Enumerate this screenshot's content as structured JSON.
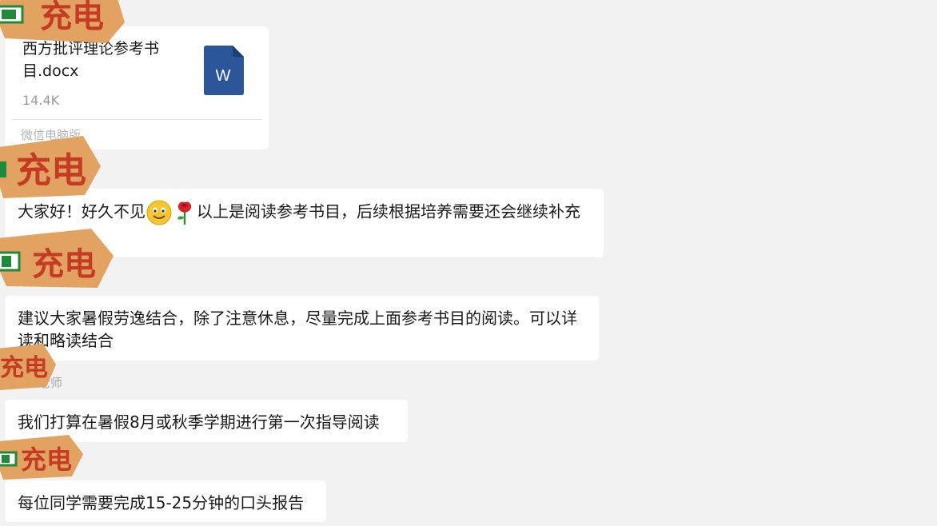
{
  "file_message": {
    "file_name": "西方批评理论参考书目.docx",
    "file_size": "14.4K",
    "source": "微信电脑版",
    "icon_letter": "W",
    "icon_color": "#2b579a"
  },
  "messages": [
    {
      "text_before": "大家好！好久不见",
      "text_after": "以上是阅读参考书目，后续根据培养需要还会继续补充"
    },
    {
      "text": "建议大家暑假劳逸结合，除了注意休息，尽量完成上面参考书目的阅读。可以详读和略读结合"
    },
    {
      "sender": "老师",
      "text": "我们打算在暑假8月或秋季学期进行第一次指导阅读"
    },
    {
      "text": "每位同学需要完成15-25分钟的口头报告"
    }
  ],
  "sticker": {
    "label": "充电",
    "colors": {
      "tag": "#e2a262",
      "text": "#c53a22",
      "battery": "#1f8a3a"
    }
  },
  "colors": {
    "background": "#f2f2f2",
    "bubble": "#ffffff"
  }
}
